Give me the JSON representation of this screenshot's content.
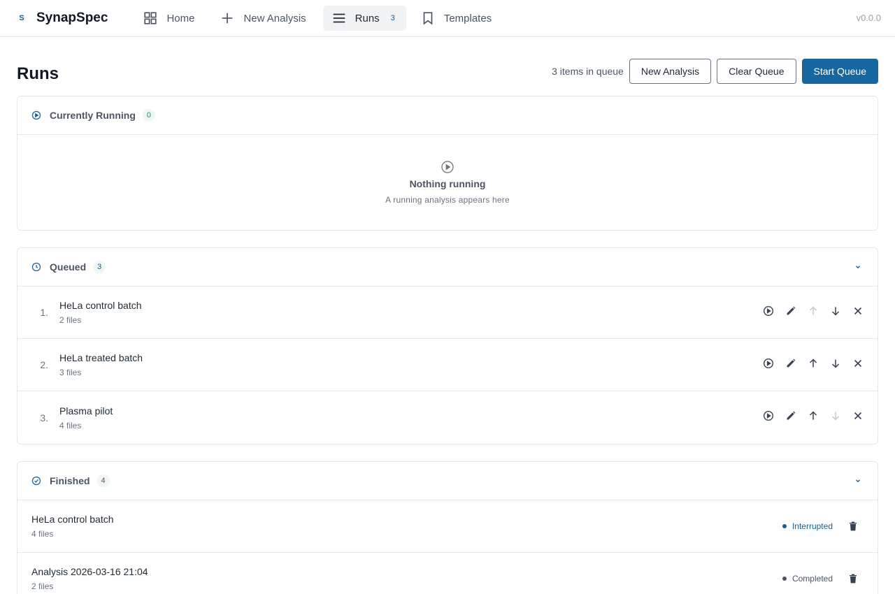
{
  "app": {
    "logo_letter": "S",
    "name": "SynapSpec",
    "version": "v0.0.0"
  },
  "nav": {
    "home": "Home",
    "new_analysis": "New Analysis",
    "runs": "Runs",
    "runs_badge": "3",
    "templates": "Templates"
  },
  "page": {
    "title": "Runs",
    "queue_count": "3 items in queue",
    "btn_new": "New Analysis",
    "btn_clear": "Clear Queue",
    "btn_start": "Start Queue"
  },
  "running": {
    "title": "Currently Running",
    "count": "0",
    "empty_title": "Nothing running",
    "empty_sub": "A running analysis appears here"
  },
  "queued": {
    "title": "Queued",
    "count": "3",
    "items": [
      {
        "num": "1.",
        "name": "HeLa control batch",
        "files": "2 files"
      },
      {
        "num": "2.",
        "name": "HeLa treated batch",
        "files": "3 files"
      },
      {
        "num": "3.",
        "name": "Plasma pilot",
        "files": "4 files"
      }
    ]
  },
  "finished": {
    "title": "Finished",
    "count": "4",
    "items": [
      {
        "name": "HeLa control batch",
        "files": "4 files",
        "status": "Interrupted"
      },
      {
        "name": "Analysis 2026-03-16 21:04",
        "files": "2 files",
        "status": "Completed"
      }
    ]
  },
  "colors": {
    "accent": "#16679f",
    "interrupted": "#1a5d8c",
    "completed": "#4b5563",
    "running_badge_text": "#1e9a5c",
    "queued_badge_text": "#1a5d8c"
  }
}
